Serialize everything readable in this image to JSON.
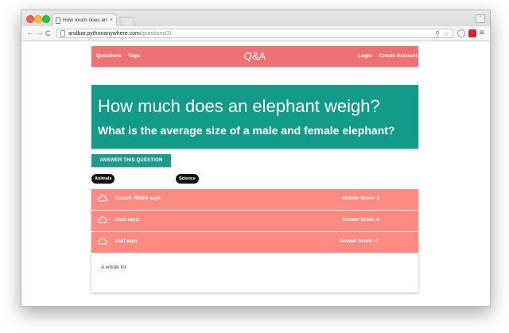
{
  "browser": {
    "tab_title": "How much does an elephant weigh",
    "tab_close": "×",
    "url_host": "andbar.pythonanywhere.com",
    "url_path": "/questions/2/",
    "back": "←",
    "forward": "→",
    "reload": "C",
    "zoom_icon": "⚲",
    "star_icon": "☆",
    "menu_icon": "≡",
    "profile": "⌃",
    "icons": [
      "close-light",
      "minimize-light",
      "maximize-light",
      "back-arrow-icon",
      "forward-arrow-icon",
      "reload-icon",
      "zoom-icon",
      "star-icon",
      "extension-icon",
      "menu-icon"
    ]
  },
  "site_nav": {
    "questions": "Questions",
    "tags": "Tags",
    "brand": "Q&A",
    "login": "Login",
    "create_account": "Create Account"
  },
  "question": {
    "title": "How much does an elephant weigh?",
    "subtitle": "What is the average size of a male and female elephant?"
  },
  "answer_button": "ANSWER THIS QUESTION",
  "tags": [
    "Animals",
    "Science"
  ],
  "answers": [
    {
      "author": "Cousin_Rickie says:",
      "score": "Answer Score: 3"
    },
    {
      "author": "Zach says:",
      "score": "Answer Score: 0"
    },
    {
      "author": "asdf says:",
      "score": "Answer Score: -1"
    }
  ],
  "expanded_answer_body": "A whole lot",
  "colors": {
    "nav": "#f07173",
    "hero": "#129b88",
    "button": "#1e9b8d",
    "answer_row": "#fb8a80",
    "tag_chip": "#111111"
  }
}
